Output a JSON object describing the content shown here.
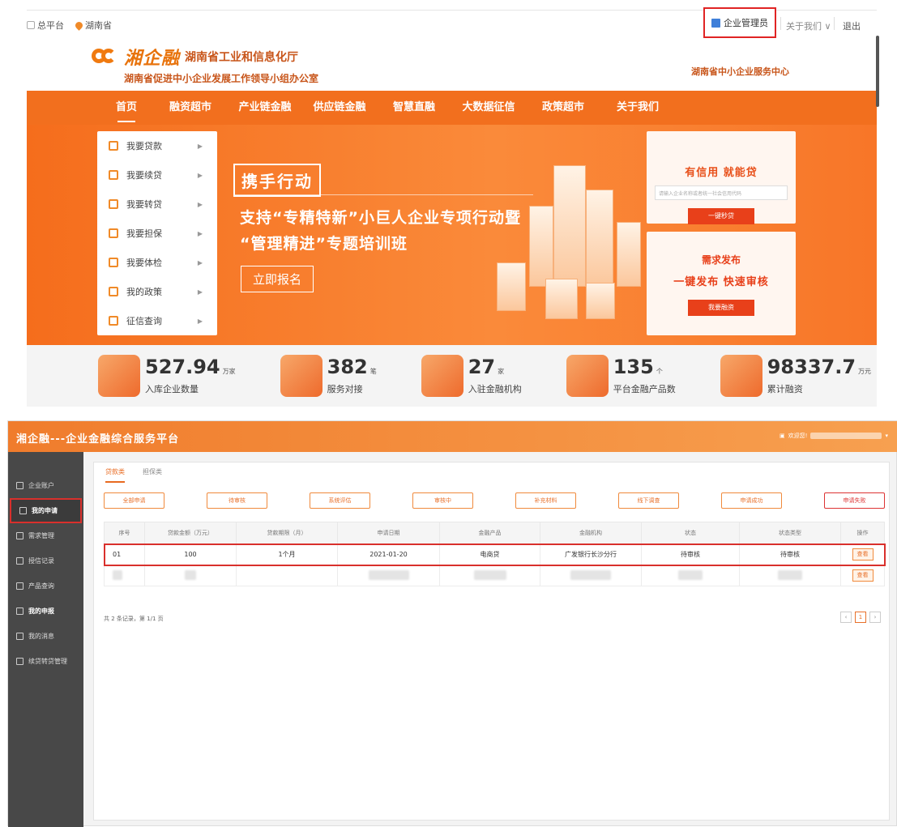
{
  "site": {
    "topbar": {
      "platform": "总平台",
      "province": "湖南省",
      "admin": "企业管理员",
      "about": "关于我们 ∨",
      "logout": "退出"
    },
    "logo": {
      "script": "湘企融",
      "org1": "湖南省工业和信息化厅",
      "org2": "湖南省促进中小企业发展工作领导小组办公室",
      "center": "湖南省中小企业服务中心"
    },
    "nav": [
      "首页",
      "融资超市",
      "产业链金融",
      "供应链金融",
      "智慧直融",
      "大数据征信",
      "政策超市",
      "关于我们"
    ],
    "menu": [
      "我要贷款",
      "我要续贷",
      "我要转贷",
      "我要担保",
      "我要体检",
      "我的政策",
      "征信查询"
    ],
    "banner": {
      "tag": "携手行动",
      "line1": "支持“专精特新”小巨人企业专项行动暨",
      "line2": "“管理精进”专题培训班",
      "cta": "立即报名"
    },
    "panel1": {
      "title": "有信用 就能贷",
      "placeholder": "请输入企业名称或者统一社会信用代码",
      "btn": "一键秒贷"
    },
    "panel2": {
      "title": "需求发布",
      "subtitle": "一键发布 快速审核",
      "btn": "我要融资"
    },
    "stats": [
      {
        "value": "527.94",
        "unit": "万家",
        "label": "入库企业数量"
      },
      {
        "value": "382",
        "unit": "笔",
        "label": "服务对接"
      },
      {
        "value": "27",
        "unit": "家",
        "label": "入驻金融机构"
      },
      {
        "value": "135",
        "unit": "个",
        "label": "平台金融产品数"
      },
      {
        "value": "98337.7",
        "unit": "万元",
        "label": "累计融资"
      }
    ]
  },
  "app": {
    "title": "湘企融---企业金融综合服务平台",
    "welcome": "欢迎您!",
    "sidebar": [
      "企业账户",
      "我的申请",
      "需求管理",
      "授信记录",
      "产品查询",
      "我的申报",
      "我的消息",
      "续贷转贷管理"
    ],
    "tabs": [
      "贷款类",
      "担保类"
    ],
    "filters": [
      "全部申请",
      "待审核",
      "系统评估",
      "审核中",
      "补充材料",
      "线下调查",
      "申请成功",
      "申请失败"
    ],
    "columns": [
      "序号",
      "贷款金额（万元）",
      "贷款期限（月）",
      "申请日期",
      "金融产品",
      "金融机构",
      "状态",
      "状态类型",
      "操作"
    ],
    "rows": [
      {
        "no": "01",
        "amount": "100",
        "term": "1个月",
        "date": "2021-01-20",
        "product": "电商贷",
        "bank": "广发银行长沙分行",
        "status": "待审核",
        "type": "待审核",
        "op": "查看"
      }
    ],
    "row2_op": "查看",
    "footer": "共 2 条记录，第 1/1 页",
    "page": "1"
  }
}
